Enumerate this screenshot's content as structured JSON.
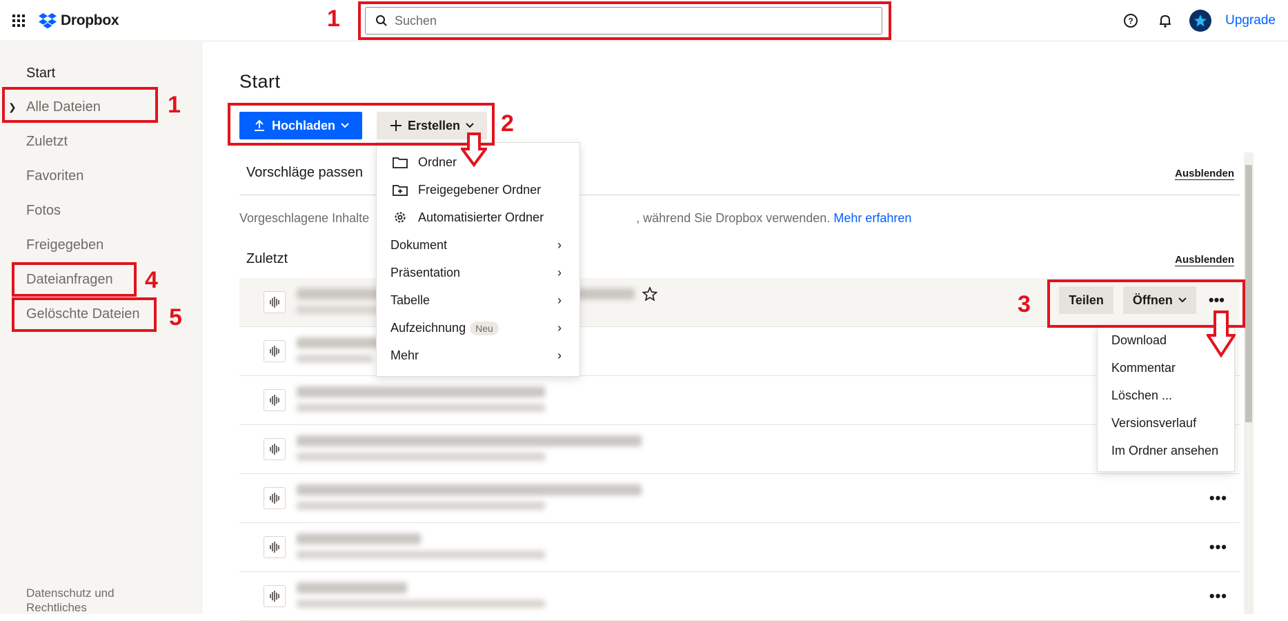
{
  "topbar": {
    "logo_text": "Dropbox",
    "search_placeholder": "Suchen",
    "upgrade_label": "Upgrade"
  },
  "sidebar": {
    "items": [
      {
        "label": "Start"
      },
      {
        "label": "Alle Dateien"
      },
      {
        "label": "Zuletzt"
      },
      {
        "label": "Favoriten"
      },
      {
        "label": "Fotos"
      },
      {
        "label": "Freigegeben"
      },
      {
        "label": "Dateianfragen"
      },
      {
        "label": "Gelöschte Dateien"
      }
    ],
    "footer": "Datenschutz und Rechtliches"
  },
  "main": {
    "title": "Start",
    "upload_label": "Hochladen",
    "create_label": "Erstellen",
    "suggestions": {
      "title": "Vorschläge passen",
      "hide_label": "Ausblenden",
      "text_start": "Vorgeschlagene Inhalte",
      "text_end": ", während Sie Dropbox verwenden.",
      "link": "Mehr erfahren"
    },
    "recent": {
      "title": "Zuletzt",
      "hide_label": "Ausblenden",
      "share_label": "Teilen",
      "open_label": "Öffnen",
      "more_label": "•••"
    }
  },
  "create_menu": {
    "items": [
      {
        "label": "Ordner",
        "icon": "folder-icon"
      },
      {
        "label": "Freigegebener Ordner",
        "icon": "shared-folder-icon"
      },
      {
        "label": "Automatisierter Ordner",
        "icon": "automated-folder-icon"
      },
      {
        "label": "Dokument",
        "arrow": "›"
      },
      {
        "label": "Präsentation",
        "arrow": "›"
      },
      {
        "label": "Tabelle",
        "arrow": "›"
      },
      {
        "label": "Aufzeichnung",
        "badge": "Neu",
        "arrow": "›"
      },
      {
        "label": "Mehr",
        "arrow": "›"
      }
    ]
  },
  "more_menu": {
    "items": [
      {
        "label": "Download"
      },
      {
        "label": "Kommentar"
      },
      {
        "label": "Löschen ..."
      },
      {
        "label": "Versionsverlauf"
      },
      {
        "label": "Im Ordner ansehen"
      }
    ]
  },
  "annotations": {
    "n1": "1",
    "n2": "2",
    "n3": "3",
    "n4": "4",
    "n5": "5"
  },
  "colors": {
    "accent": "#0061fe",
    "annotation": "#e1141e"
  }
}
